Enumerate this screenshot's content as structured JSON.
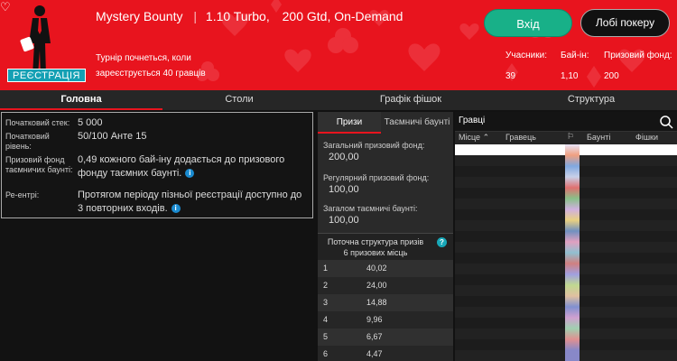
{
  "header": {
    "heart_icon": "heart-icon",
    "registration_badge": "РЕЄСТРАЦІЯ",
    "title_parts": [
      "Mystery Bounty",
      "1.10 Turbo,",
      "200 Gtd, On-Demand"
    ],
    "subtitle_line1": "Турнір почнеться, коли",
    "subtitle_line2": "зареєструється 40 гравців",
    "stats": [
      {
        "label": "Учасники:",
        "value": "39"
      },
      {
        "label": "Бай-ін:",
        "value": "1,10"
      },
      {
        "label": "Призовий фонд:",
        "value": "200"
      }
    ],
    "enter_button": "Вхід",
    "lobby_button": "Лобі покеру",
    "colors": {
      "red": "#e8141e",
      "teal": "#14a0b4",
      "green": "#18b088"
    }
  },
  "tabs": [
    {
      "label": "Головна",
      "active": true
    },
    {
      "label": "Столи",
      "active": false
    },
    {
      "label": "Графік фішок",
      "active": false
    },
    {
      "label": "Структура",
      "active": false
    }
  ],
  "info": [
    {
      "label": "Початковий стек:",
      "value": "5 000"
    },
    {
      "label": "Початковий рівень:",
      "value": "50/100 Анте 15"
    },
    {
      "label": "Призовий фонд таємничих баунті:",
      "value": "0,49 кожного бай-іну додається до призового фонду таємних баунті."
    },
    {
      "label": "Ре-ентрі:",
      "value": "Протягом періоду пізньої реєстрації доступно до 3 повторних входів."
    }
  ],
  "prizes": {
    "tabs": [
      "Призи",
      "Таємничі баунті"
    ],
    "total_label": "Загальний призовий фонд:",
    "total_value": "200,00",
    "regular_label": "Регулярний призовий фонд:",
    "regular_value": "100,00",
    "bounty_label": "Загалом таємничі баунті:",
    "bounty_value": "100,00",
    "structure_title": "Поточна структура призів",
    "structure_sub": "6 призових місць",
    "places": [
      {
        "n": "1",
        "v": "40,02"
      },
      {
        "n": "2",
        "v": "24,00"
      },
      {
        "n": "3",
        "v": "14,88"
      },
      {
        "n": "4",
        "v": "9,96"
      },
      {
        "n": "5",
        "v": "6,67"
      },
      {
        "n": "6",
        "v": "4,47"
      }
    ]
  },
  "players": {
    "search_label": "Гравці",
    "columns": [
      "Місце",
      "Гравець",
      "Баунті",
      "Фішки"
    ]
  }
}
